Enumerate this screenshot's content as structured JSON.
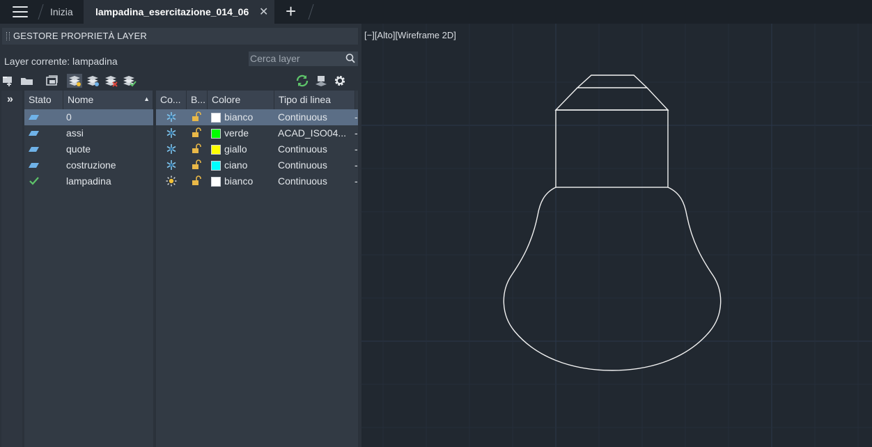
{
  "tabs": {
    "home_label": "Inizia",
    "active_label": "lampadina_esercitazione_014_06",
    "close_glyph": "✕",
    "new_tab_glyph": "+"
  },
  "panel": {
    "title": "GESTORE PROPRIETÀ LAYER",
    "current_layer_text": "Layer corrente: lampadina",
    "search_placeholder": "Cerca layer",
    "collapse_glyph": "»",
    "columns_left": [
      "Stato",
      "Nome"
    ],
    "columns_right": [
      "Co...",
      "B...",
      "Colore",
      "Tipo di linea"
    ],
    "toolbar_icons": [
      "new-layer-icon",
      "new-folder-icon",
      "layer-states-icon",
      "new-layer-vp-icon",
      "layer-freeze-vp-icon",
      "delete-layer-icon",
      "set-current-icon",
      "refresh-icon",
      "layer-settings-toggle-icon",
      "gear-icon"
    ],
    "layers": [
      {
        "name": "0",
        "status": "layer",
        "freeze": "snowflake",
        "lock": "unlocked",
        "color_name": "bianco",
        "color_hex": "#ffffff",
        "linetype": "Continuous",
        "selected": true
      },
      {
        "name": "assi",
        "status": "layer",
        "freeze": "snowflake",
        "lock": "unlocked",
        "color_name": "verde",
        "color_hex": "#00ff00",
        "linetype": "ACAD_ISO04...",
        "selected": false
      },
      {
        "name": "quote",
        "status": "layer",
        "freeze": "snowflake",
        "lock": "unlocked",
        "color_name": "giallo",
        "color_hex": "#ffff00",
        "linetype": "Continuous",
        "selected": false
      },
      {
        "name": "costruzione",
        "status": "layer",
        "freeze": "snowflake",
        "lock": "unlocked",
        "color_name": "ciano",
        "color_hex": "#00ffff",
        "linetype": "Continuous",
        "selected": false
      },
      {
        "name": "lampadina",
        "status": "current",
        "freeze": "sun",
        "lock": "unlocked",
        "color_name": "bianco",
        "color_hex": "#ffffff",
        "linetype": "Continuous",
        "selected": false
      }
    ],
    "colors": {
      "selected_row": "#5b6e86",
      "current_check": "#5ec46a",
      "status_blue": "#6fb2e8"
    }
  },
  "viewport": {
    "label": "[−][Alto][Wireframe 2D]",
    "drawing": "light-bulb-outline",
    "colors": {
      "background": "#212830",
      "grid": "#2c3a4e",
      "line": "#ffffff"
    }
  }
}
